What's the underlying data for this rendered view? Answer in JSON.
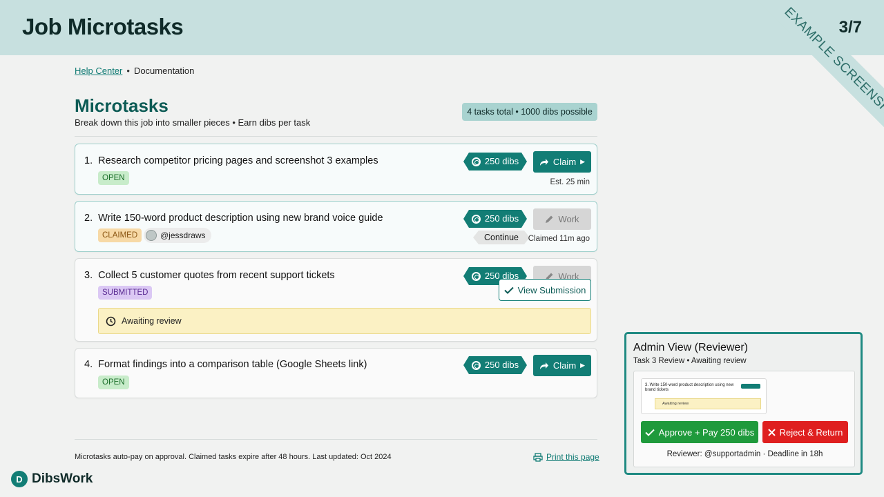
{
  "header": {
    "title": "Job Microtasks",
    "page_counter": "3/7",
    "ribbon": "EXAMPLE SCREENSHOT"
  },
  "breadcrumb": {
    "link": "Help Center",
    "current": "Documentation"
  },
  "main": {
    "heading": "Microtasks",
    "subtitle": "Break down this job into smaller pieces • Earn dibs per task",
    "summary": "4 tasks total • 1000 dibs possible"
  },
  "tasks": [
    {
      "number": "1.",
      "title": "Research competitor pricing pages and screenshot 3 examples",
      "status": "OPEN",
      "dibs": "250 dibs",
      "action": "Claim",
      "meta": "Est. 25 min"
    },
    {
      "number": "2.",
      "title": "Write 150-word product description using new brand voice guide",
      "status": "CLAIMED",
      "user": "@jessdraws",
      "dibs": "250 dibs",
      "action": "Work",
      "continue": "Continue",
      "meta": "Claimed 11m ago"
    },
    {
      "number": "3.",
      "title": "Collect 5 customer quotes from recent support tickets",
      "status": "SUBMITTED",
      "dibs": "250 dibs",
      "action": "Work",
      "view": "View Submission",
      "awaiting": "Awaiting review"
    },
    {
      "number": "4.",
      "title": "Format findings into a comparison table (Google Sheets link)",
      "status": "OPEN",
      "dibs": "250 dibs",
      "action": "Claim"
    }
  ],
  "footer": {
    "note": "Microtasks auto-pay on approval. Claimed tasks expire after 48 hours. Last updated: Oct 2024",
    "print": "Print this page",
    "brand": "DibsWork"
  },
  "admin": {
    "title": "Admin View (Reviewer)",
    "subtitle": "Task 3 Review • Awaiting review",
    "thumb_title": "3. Write 150-word product description using new brand tickets",
    "thumb_status": "Awaiting review",
    "approve": "Approve + Pay 250 dibs",
    "reject": "Reject & Return",
    "reviewer": "Reviewer: @supportadmin · Deadline in 18h"
  },
  "colors": {
    "accent": "#127d75",
    "header_bg": "#c7e0df",
    "approve": "#1f9a3c",
    "reject": "#df1f1f"
  }
}
